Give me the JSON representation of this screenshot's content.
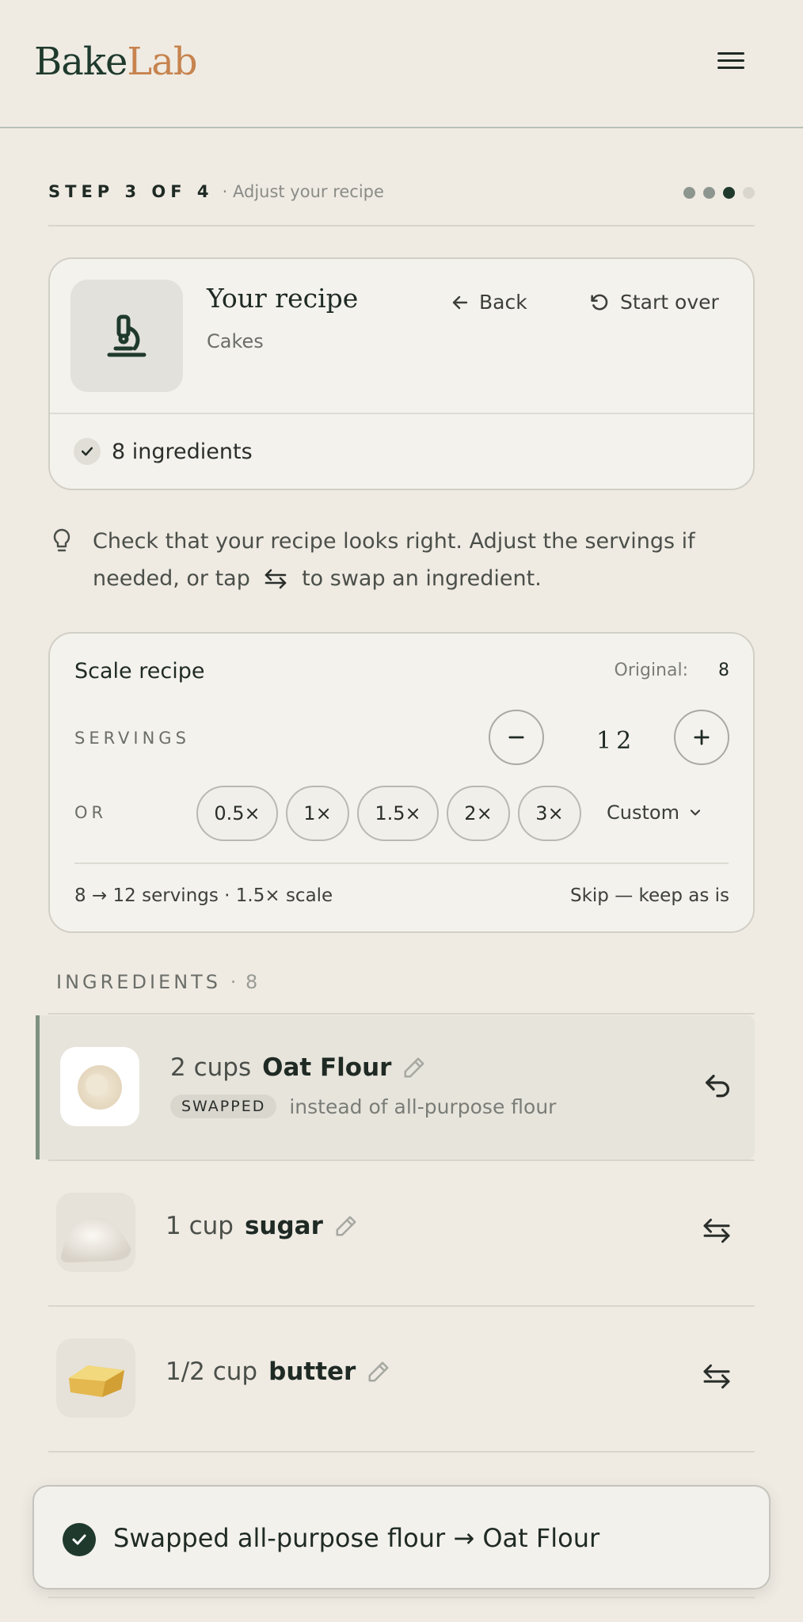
{
  "brand": {
    "part1": "Bake",
    "part2": "Lab"
  },
  "step": {
    "label": "STEP 3 OF 4",
    "sub": "· Adjust your recipe",
    "dots": [
      "#8d968e",
      "#8d968e",
      "#1f3a2d",
      "#d9d6ce"
    ]
  },
  "recipe": {
    "title": "Your recipe",
    "category": "Cakes",
    "back_label": "Back",
    "start_over_label": "Start over",
    "ingredient_count_label": "8 ingredients"
  },
  "hint": {
    "before": "Check that your recipe looks right. Adjust the servings if needed, or tap",
    "after": "to swap an ingredient."
  },
  "scale": {
    "title": "Scale recipe",
    "original_label": "Original:",
    "original_value": "8",
    "servings_label": "SERVINGS",
    "servings_value": "12",
    "or_label": "OR",
    "chips": [
      "0.5×",
      "1×",
      "1.5×",
      "2×",
      "3×"
    ],
    "custom_label": "Custom",
    "summary": "8 → 12 servings · 1.5× scale",
    "skip_label": "Skip — keep as is"
  },
  "ingredients": {
    "heading": "INGREDIENTS",
    "count": "· 8",
    "items": [
      {
        "qty": "2 cups",
        "name": "Oat Flour",
        "badge": "SWAPPED",
        "note": "instead of all-purpose flour",
        "swapped": true
      },
      {
        "qty": "1 cup",
        "name": "sugar",
        "swapped": false
      },
      {
        "qty": "1/2 cup",
        "name": "butter",
        "swapped": false
      }
    ]
  },
  "toast": {
    "text": "Swapped all-purpose flour → Oat Flour"
  },
  "colors": {
    "accent": "#1f3a2d",
    "brand_orange": "#c7834e",
    "background": "#efebe3"
  }
}
